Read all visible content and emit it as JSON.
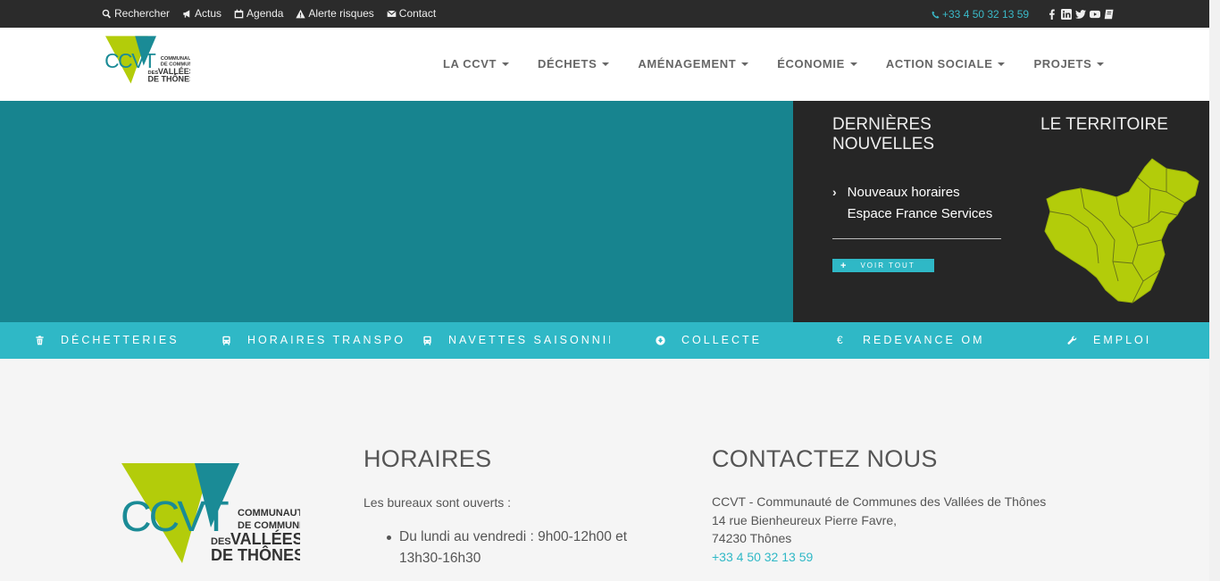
{
  "topbar": {
    "links": [
      {
        "label": "Rechercher",
        "icon": "search-icon"
      },
      {
        "label": "Actus",
        "icon": "bullhorn-icon"
      },
      {
        "label": "Agenda",
        "icon": "calendar-icon"
      },
      {
        "label": "Alerte risques",
        "icon": "warning-icon"
      },
      {
        "label": "Contact",
        "icon": "envelope-icon"
      }
    ],
    "phone": "+33 4 50 32 13 59",
    "socials": [
      "facebook-icon",
      "linkedin-icon",
      "twitter-icon",
      "youtube-icon",
      "book-icon"
    ]
  },
  "logo": {
    "mark": "CCVT",
    "line1": "COMMUNAUTÉ",
    "line2": "DE COMMUNES",
    "line3a": "DES",
    "line3b": "VALLÉES",
    "line4": "DE THÔNES"
  },
  "nav": [
    "LA CCVT",
    "DÉCHETS",
    "AMÉNAGEMENT",
    "ÉCONOMIE",
    "ACTION SOCIALE",
    "PROJETS"
  ],
  "news": {
    "title": "DERNIÈRES NOUVELLES",
    "item": "Nouveaux horaires Espace France Services",
    "more": "VOIR TOUT"
  },
  "territoire": {
    "title": "LE TERRITOIRE"
  },
  "quicklinks": [
    {
      "label": "DÉCHETTERIES",
      "icon": "trash-icon"
    },
    {
      "label": "HORAIRES TRANSPORTS",
      "icon": "bus-icon"
    },
    {
      "label": "NAVETTES SAISONNIÈRES",
      "icon": "bus-icon"
    },
    {
      "label": "COLLECTE",
      "icon": "arrow-circle-icon"
    },
    {
      "label": "REDEVANCE OM",
      "icon": "euro-icon"
    },
    {
      "label": "EMPLOI",
      "icon": "wrench-icon"
    }
  ],
  "horaires": {
    "title": "HORAIRES",
    "lead": "Les bureaux sont ouverts :",
    "item": "Du lundi au vendredi : 9h00-12h00 et 13h30-16h30"
  },
  "contact": {
    "title": "CONTACTEZ NOUS",
    "name": "CCVT - Communauté de Communes des Vallées de Thônes",
    "street": "14 rue Bienheureux Pierre Favre,",
    "city": "74230 Thônes",
    "phone": "+33 4 50 32 13 59"
  },
  "colors": {
    "teal": "#17848f",
    "cyan": "#2fb8c6",
    "dark": "#262626",
    "lime": "#b3cc0a"
  }
}
